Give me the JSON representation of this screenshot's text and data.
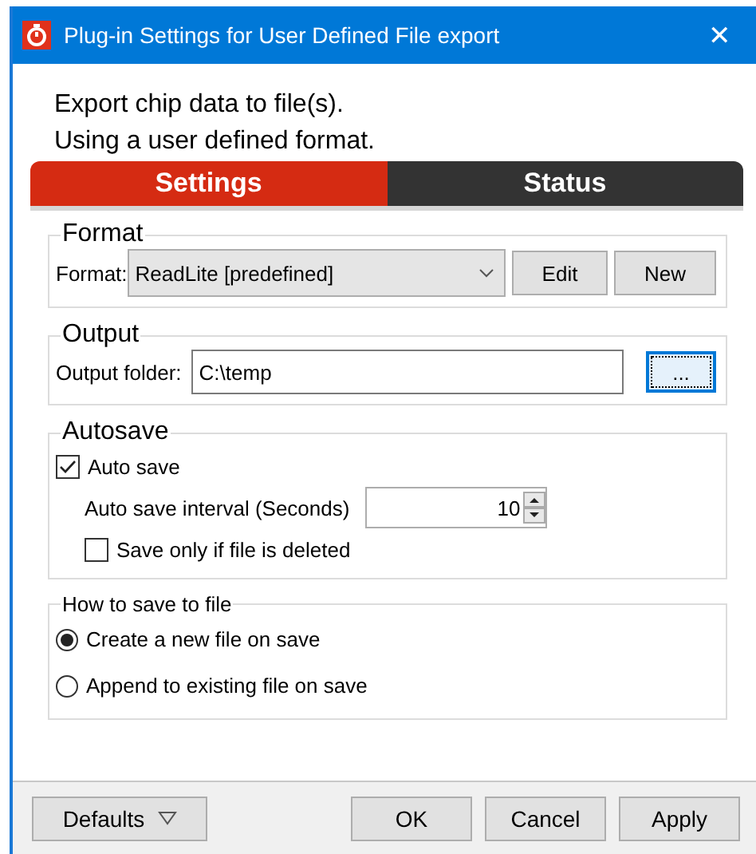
{
  "window": {
    "title": "Plug-in Settings for User Defined File export",
    "close": "✕"
  },
  "header": {
    "lines": [
      "Export chip data to file(s).",
      "Using a user defined format."
    ]
  },
  "tabs": [
    {
      "label": "Settings",
      "selected": true
    },
    {
      "label": "Status",
      "selected": false
    }
  ],
  "format": {
    "title": "Format",
    "label": "Format:",
    "value": "ReadLite [predefined]",
    "buttons": [
      "Edit",
      "New"
    ]
  },
  "output": {
    "title": "Output",
    "label": "Output folder:",
    "value": "C:\\temp",
    "browse": "..."
  },
  "autosave": {
    "title": "Autosave",
    "auto_save": {
      "label": "Auto save",
      "checked": true
    },
    "interval": {
      "label": "Auto save interval (Seconds)",
      "value": "10"
    },
    "save_only": {
      "label": "Save only if file is deleted",
      "checked": false
    }
  },
  "save_mode": {
    "title": "How to save to file",
    "options": [
      {
        "label": "Create a new file on save",
        "selected": true
      },
      {
        "label": "Append to existing file on save",
        "selected": false
      }
    ]
  },
  "footer": {
    "defaults": "Defaults",
    "buttons": [
      "OK",
      "Cancel",
      "Apply"
    ]
  }
}
